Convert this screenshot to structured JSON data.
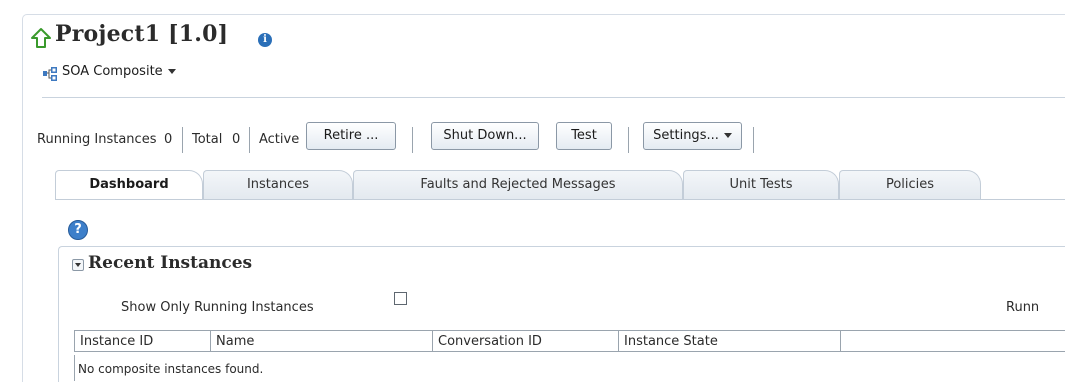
{
  "header": {
    "title": "Project1 [1.0]",
    "info_icon": "info-icon",
    "composite_menu_label": "SOA Composite"
  },
  "toolbar": {
    "running_instances_label": "Running Instances",
    "running_instances_value": "0",
    "total_label": "Total",
    "total_value": "0",
    "active_label": "Active",
    "retire_button": "Retire ...",
    "shutdown_button": "Shut Down...",
    "test_button": "Test",
    "settings_button": "Settings..."
  },
  "tabs": [
    {
      "label": "Dashboard",
      "active": true
    },
    {
      "label": "Instances",
      "active": false
    },
    {
      "label": "Faults and Rejected Messages",
      "active": false
    },
    {
      "label": "Unit Tests",
      "active": false
    },
    {
      "label": "Policies",
      "active": false
    }
  ],
  "recent_instances": {
    "title": "Recent Instances",
    "show_only_running_label": "Show Only Running Instances",
    "show_only_running_checked": false,
    "right_cut_label": "Runn",
    "columns": [
      "Instance ID",
      "Name",
      "Conversation ID",
      "Instance State"
    ],
    "empty_message": "No composite instances found."
  },
  "colors": {
    "accent": "#2a6fb8",
    "home_icon": "#3a9a2c",
    "border": "#c3cdd8"
  }
}
